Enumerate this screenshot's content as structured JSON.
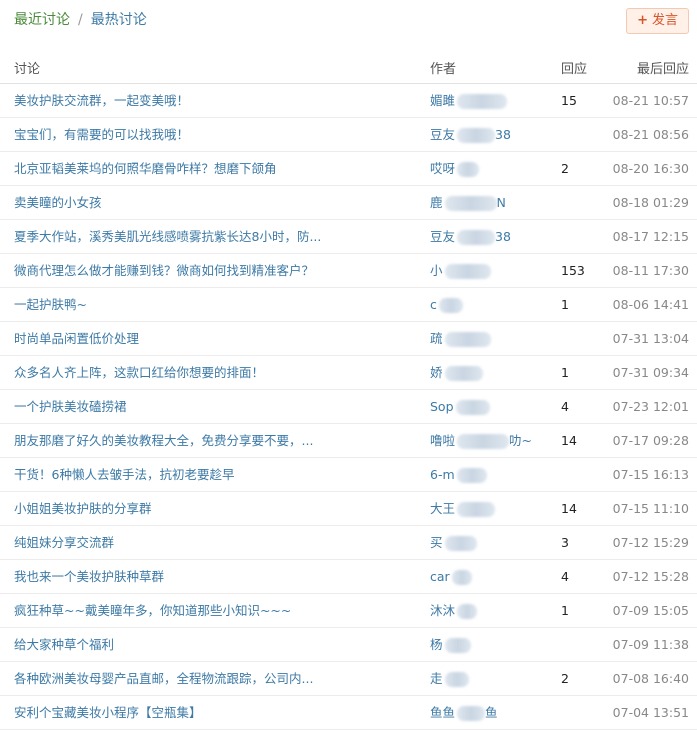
{
  "tabs": {
    "recent": "最近讨论",
    "separator": "/",
    "hot": "最热讨论"
  },
  "post_button": {
    "icon": "+",
    "label": "发言"
  },
  "table": {
    "headers": {
      "title": "讨论",
      "author": "作者",
      "replies": "回应",
      "last_reply": "最后回应"
    },
    "rows": [
      {
        "title": "美妆护肤交流群，一起变美哦！",
        "author": "媚雎",
        "replies": "15",
        "time": "08-21 10:57"
      },
      {
        "title": "宝宝们，有需要的可以找我哦！",
        "author": "豆友",
        "author_tail": "38",
        "replies": "",
        "time": "08-21 08:56"
      },
      {
        "title": "北京亚韬美莱坞的何照华磨骨咋样？想磨下颌角",
        "author": "哎呀",
        "replies": "2",
        "time": "08-20 16:30"
      },
      {
        "title": "卖美瞳的小女孩",
        "author": "鹿",
        "author_tail": "N",
        "replies": "",
        "time": "08-18 01:29"
      },
      {
        "title": "夏季大作站，溪秀美肌光线感喷雾抗紫长达8小时，防...",
        "author": "豆友",
        "author_tail": "38",
        "replies": "",
        "time": "08-17 12:15"
      },
      {
        "title": "微商代理怎么做才能赚到钱？微商如何找到精准客户？",
        "author": "小",
        "replies": "153",
        "time": "08-11 17:30"
      },
      {
        "title": "一起护肤鸭~",
        "author": "c",
        "replies": "1",
        "time": "08-06 14:41"
      },
      {
        "title": "时尚单品闲置低价处理",
        "author": "疏",
        "replies": "",
        "time": "07-31 13:04"
      },
      {
        "title": "众多名人齐上阵，这款口红给你想要的排面！",
        "author": "娇",
        "replies": "1",
        "time": "07-31 09:34"
      },
      {
        "title": "一个护肤美妆磕捞裙",
        "author": "Sop",
        "replies": "4",
        "time": "07-23 12:01"
      },
      {
        "title": "朋友那磨了好久的美妆教程大全，免费分享要不要，...",
        "author": "噜啦",
        "author_tail": "叻~",
        "replies": "14",
        "time": "07-17 09:28"
      },
      {
        "title": "干货！6种懒人去皱手法，抗初老要趁早",
        "author": "6-m",
        "replies": "",
        "time": "07-15 16:13"
      },
      {
        "title": "小姐姐美妆护肤的分享群",
        "author": "大王",
        "replies": "14",
        "time": "07-15 11:10"
      },
      {
        "title": "纯姐妹分享交流群",
        "author": "买",
        "replies": "3",
        "time": "07-12 15:29"
      },
      {
        "title": "我也来一个美妆护肤种草群",
        "author": "car",
        "replies": "4",
        "time": "07-12 15:28"
      },
      {
        "title": "疯狂种草~~戴美瞳年多，你知道那些小知识~~~",
        "author": "沐沐",
        "replies": "1",
        "time": "07-09 15:05"
      },
      {
        "title": "给大家种草个福利",
        "author": "杨",
        "replies": "",
        "time": "07-09 11:38"
      },
      {
        "title": "各种欧洲美妆母婴产品直邮，全程物流跟踪，公司内...",
        "author": "走",
        "replies": "2",
        "time": "07-08 16:40"
      },
      {
        "title": "安利个宝藏美妆小程序【空瓶集】",
        "author": "鱼鱼",
        "author_tail": "鱼",
        "replies": "",
        "time": "07-04 13:51"
      }
    ]
  },
  "colors": {
    "link": "#3d7aa6",
    "active_tab": "#4a8a3a",
    "button_text": "#d6562b",
    "button_bg": "#fff0e8",
    "time": "#888888"
  }
}
